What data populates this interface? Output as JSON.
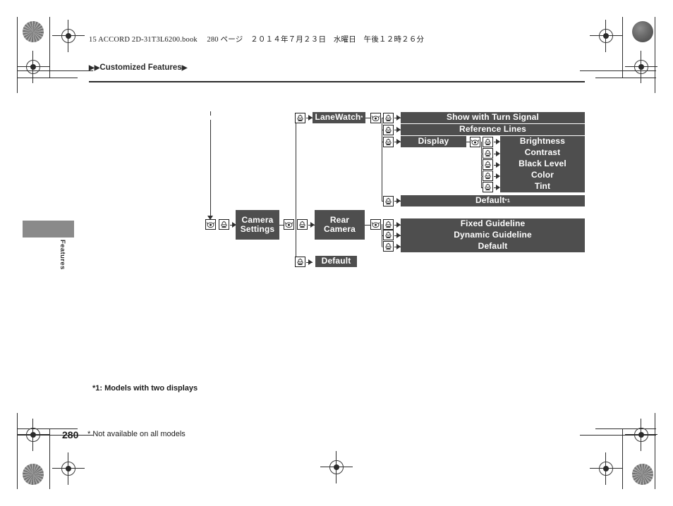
{
  "page": {
    "header_text": "15 ACCORD 2D-31T3L6200.book 　280 ページ　２０１４年７月２３日　水曜日　午後１２時２６分",
    "breadcrumb": "Customized Features",
    "breadcrumb_lead": "▶▶",
    "breadcrumb_trail": "▶",
    "side_tab_label": "Features",
    "page_number": "280",
    "footnote_star": "* Not available on all models",
    "footnote_1": "*1: Models with two displays",
    "box_color": "#4e4e4e",
    "line_color": "#2f2f2f",
    "tab_color": "#8a8a8a"
  },
  "diagram": {
    "type": "menu-tree",
    "root": {
      "label": "Camera Settings",
      "line1": "Camera",
      "line2": "Settings"
    },
    "branches": [
      {
        "label": "LaneWatch",
        "superscript": "*",
        "children": [
          {
            "label": "Show with Turn Signal"
          },
          {
            "label": "Reference Lines"
          },
          {
            "label": "Display",
            "children": [
              {
                "label": "Brightness"
              },
              {
                "label": "Contrast"
              },
              {
                "label": "Black Level"
              },
              {
                "label": "Color"
              },
              {
                "label": "Tint"
              }
            ]
          },
          {
            "label": "Default",
            "superscript": "*1"
          }
        ]
      },
      {
        "label": "Rear Camera",
        "line1": "Rear",
        "line2": "Camera",
        "children": [
          {
            "label": "Fixed Guideline"
          },
          {
            "label": "Dynamic Guideline"
          },
          {
            "label": "Default"
          }
        ]
      },
      {
        "label": "Default"
      }
    ],
    "icons": {
      "dial": "rotary-dial-icon",
      "press": "knob-press-icon"
    }
  }
}
